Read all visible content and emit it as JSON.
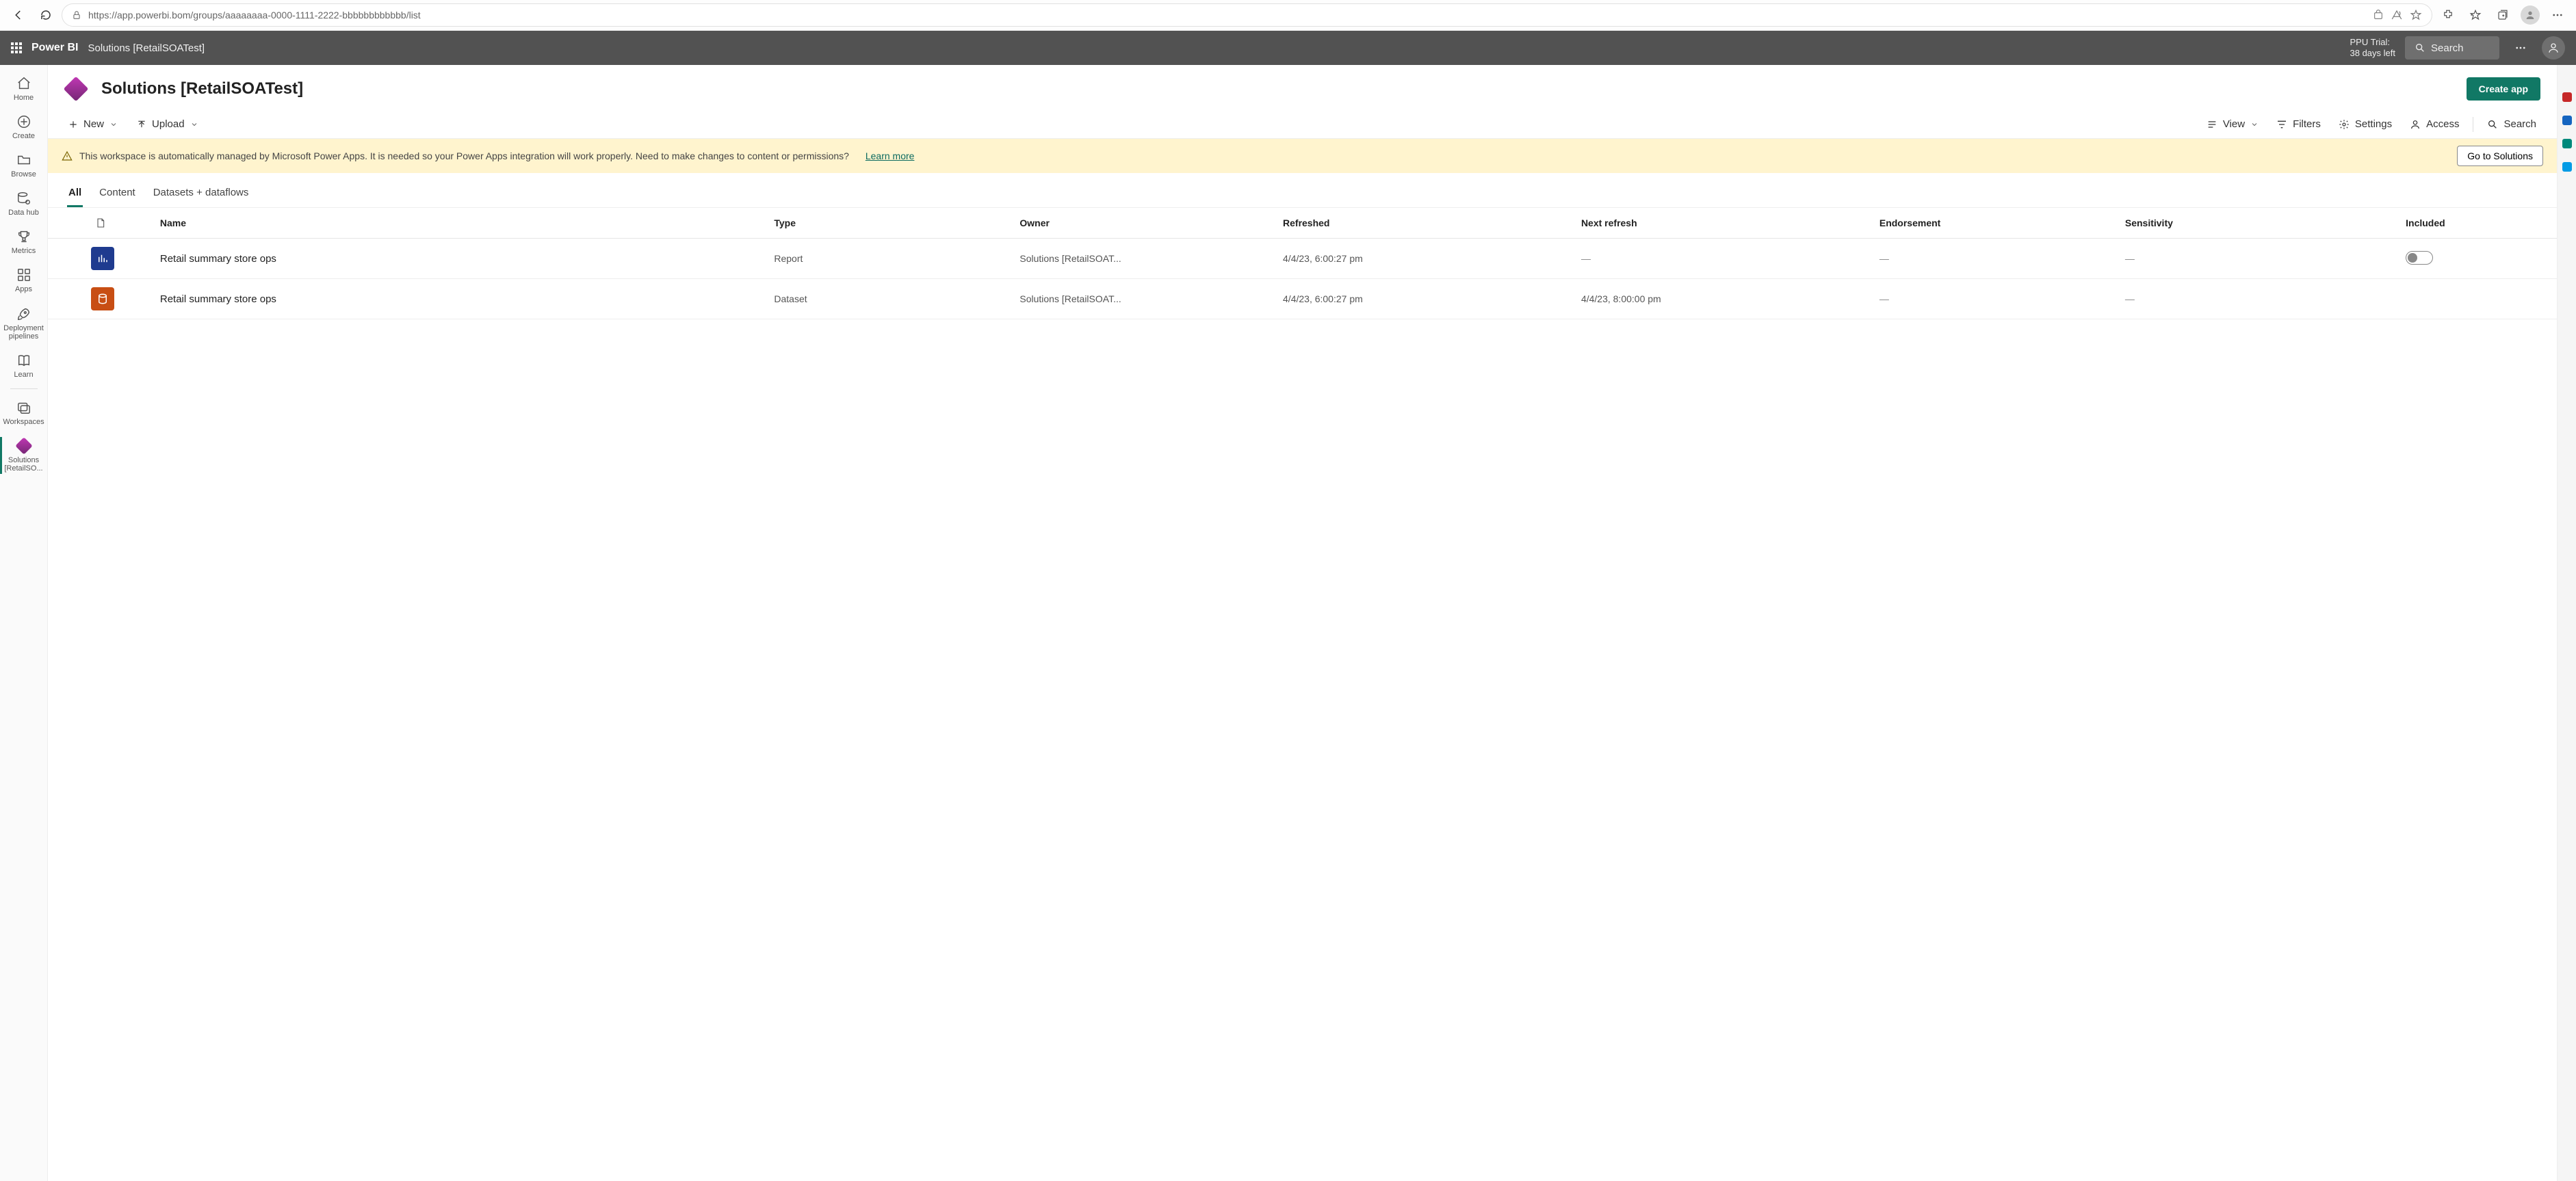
{
  "browser": {
    "url": "https://app.powerbi.bom/groups/aaaaaaaa-0000-1111-2222-bbbbbbbbbbbb/list"
  },
  "topbar": {
    "brand": "Power BI",
    "breadcrumb": "Solutions [RetailSOATest]",
    "trial_line1": "PPU Trial:",
    "trial_line2": "38 days left",
    "search_placeholder": "Search"
  },
  "leftnav": {
    "home": "Home",
    "create": "Create",
    "browse": "Browse",
    "datahub": "Data hub",
    "metrics": "Metrics",
    "apps": "Apps",
    "pipelines": "Deployment pipelines",
    "learn": "Learn",
    "workspaces": "Workspaces",
    "active_ws_line1": "Solutions",
    "active_ws_line2": "[RetailSO..."
  },
  "header": {
    "title": "Solutions [RetailSOATest]",
    "create_app": "Create app"
  },
  "toolbar": {
    "new": "New",
    "upload": "Upload",
    "view": "View",
    "filters": "Filters",
    "settings": "Settings",
    "access": "Access",
    "search": "Search"
  },
  "banner": {
    "text": "This workspace is automatically managed by Microsoft Power Apps. It is needed so your Power Apps integration will work properly. Need to make changes to content or permissions?",
    "learn_more": "Learn more",
    "button": "Go to Solutions"
  },
  "tabs": {
    "all": "All",
    "content": "Content",
    "datasets": "Datasets + dataflows"
  },
  "table": {
    "columns": {
      "name": "Name",
      "type": "Type",
      "owner": "Owner",
      "refreshed": "Refreshed",
      "next_refresh": "Next refresh",
      "endorsement": "Endorsement",
      "sensitivity": "Sensitivity",
      "included": "Included"
    },
    "rows": [
      {
        "kind": "report",
        "name": "Retail summary store ops",
        "type": "Report",
        "owner": "Solutions [RetailSOAT...",
        "refreshed": "4/4/23, 6:00:27 pm",
        "next_refresh": "—",
        "endorsement": "—",
        "sensitivity": "—",
        "included_toggle": true
      },
      {
        "kind": "dataset",
        "name": "Retail summary store ops",
        "type": "Dataset",
        "owner": "Solutions [RetailSOAT...",
        "refreshed": "4/4/23, 6:00:27 pm",
        "next_refresh": "4/4/23, 8:00:00 pm",
        "endorsement": "—",
        "sensitivity": "—",
        "included_toggle": false
      }
    ]
  }
}
